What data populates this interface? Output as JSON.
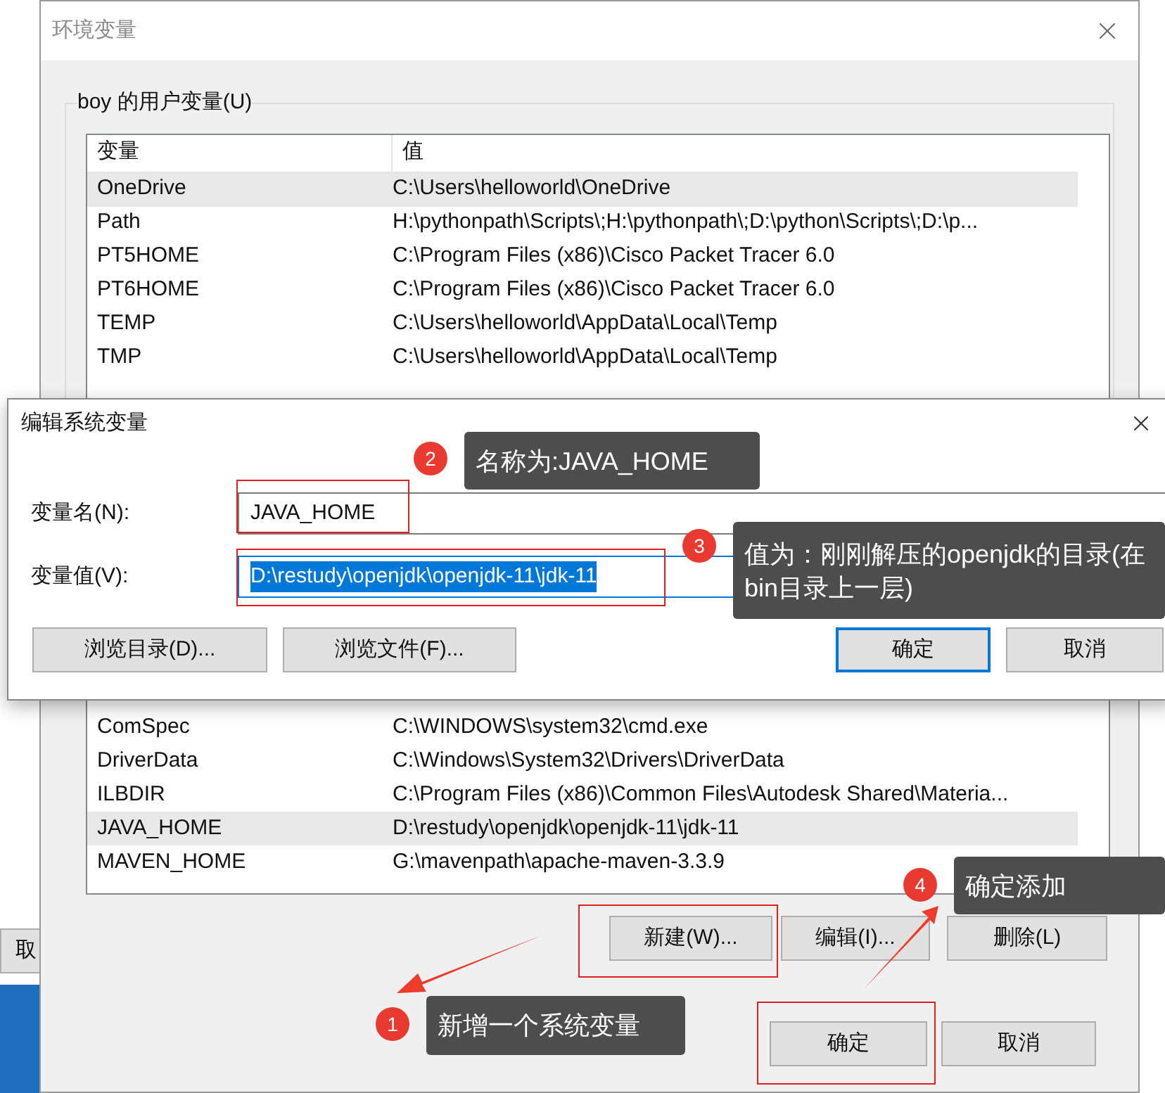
{
  "background_window": {
    "button_label": "取"
  },
  "env_dialog": {
    "title": "环境变量",
    "user_group": {
      "label": "boy 的用户变量(U)",
      "columns": [
        "变量",
        "值"
      ],
      "rows": [
        {
          "name": "OneDrive",
          "value": "C:\\Users\\helloworld\\OneDrive",
          "selected": true
        },
        {
          "name": "Path",
          "value": "H:\\pythonpath\\Scripts\\;H:\\pythonpath\\;D:\\python\\Scripts\\;D:\\p...",
          "selected": false
        },
        {
          "name": "PT5HOME",
          "value": "C:\\Program Files (x86)\\Cisco Packet Tracer 6.0",
          "selected": false
        },
        {
          "name": "PT6HOME",
          "value": "C:\\Program Files (x86)\\Cisco Packet Tracer 6.0",
          "selected": false
        },
        {
          "name": "TEMP",
          "value": "C:\\Users\\helloworld\\AppData\\Local\\Temp",
          "selected": false
        },
        {
          "name": "TMP",
          "value": "C:\\Users\\helloworld\\AppData\\Local\\Temp",
          "selected": false
        }
      ]
    },
    "system_rows": [
      {
        "name": "ComSpec",
        "value": "C:\\WINDOWS\\system32\\cmd.exe",
        "selected": false
      },
      {
        "name": "DriverData",
        "value": "C:\\Windows\\System32\\Drivers\\DriverData",
        "selected": false
      },
      {
        "name": "ILBDIR",
        "value": "C:\\Program Files (x86)\\Common Files\\Autodesk Shared\\Materia...",
        "selected": false
      },
      {
        "name": "JAVA_HOME",
        "value": "D:\\restudy\\openjdk\\openjdk-11\\jdk-11",
        "selected": true
      },
      {
        "name": "MAVEN_HOME",
        "value": "G:\\mavenpath\\apache-maven-3.3.9",
        "selected": false
      }
    ],
    "system_buttons": [
      "新建(W)...",
      "编辑(I)...",
      "删除(L)"
    ],
    "buttons": [
      "确定",
      "取消"
    ]
  },
  "edit_dialog": {
    "title": "编辑系统变量",
    "fields": [
      {
        "label": "变量名(N):",
        "value": "JAVA_HOME",
        "focused": false,
        "text_selected": false
      },
      {
        "label": "变量值(V):",
        "value": "D:\\restudy\\openjdk\\openjdk-11\\jdk-11",
        "focused": true,
        "text_selected": true
      }
    ],
    "buttons": [
      {
        "label": "浏览目录(D)...",
        "default": false
      },
      {
        "label": "浏览文件(F)...",
        "default": false
      },
      {
        "label": "确定",
        "default": true
      },
      {
        "label": "取消",
        "default": false
      }
    ]
  },
  "annotations": [
    {
      "number": "2",
      "text": "名称为:JAVA_HOME"
    },
    {
      "number": "3",
      "text": "值为：刚刚解压的openjdk的目录(在bin目录上一层)"
    },
    {
      "number": "4",
      "text": "确定添加"
    },
    {
      "number": "1",
      "text": "新增一个系统变量"
    }
  ]
}
